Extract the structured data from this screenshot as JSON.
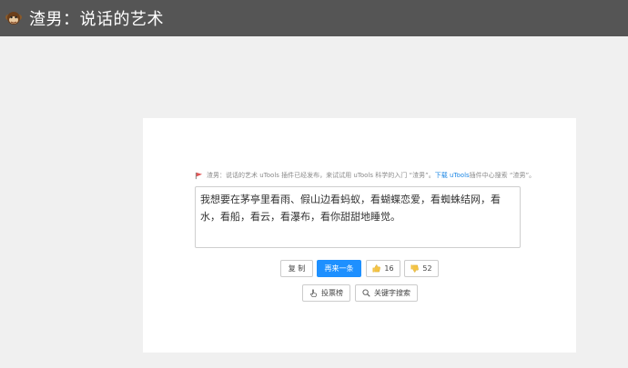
{
  "app": {
    "title": "渣男：说话的艺术"
  },
  "notice": {
    "text_before": "渣男：说话的艺术 uTools 插件已经发布，来试试用 uTools 科学的入门 “渣男”。",
    "link_text": "下载 uTools",
    "text_after": " 插件中心搜索 “渣男”。"
  },
  "quote": {
    "text": "我想要在茅亭里看雨、假山边看蚂蚁，看蝴蝶恋爱，看蜘蛛结网，看水，看船，看云，看瀑布，看你甜甜地睡觉。"
  },
  "actions": {
    "copy_label": "复 制",
    "next_label": "再来一条",
    "like_count": "16",
    "dislike_count": "52",
    "vote_label": "投票榜",
    "search_label": "关键字搜索"
  },
  "colors": {
    "topbar": "#555555",
    "primary": "#1e90ff",
    "link": "#1e88e5"
  }
}
